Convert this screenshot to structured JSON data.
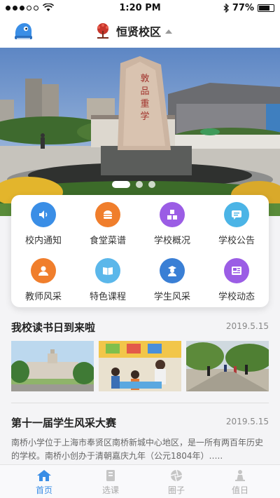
{
  "status_bar": {
    "time": "1:20 PM",
    "battery": "77%"
  },
  "header": {
    "campus": "恒贤校区"
  },
  "banner": {
    "monument_text": "敦品重学",
    "page_count": 3,
    "active_page": 0
  },
  "menu": [
    {
      "label": "校内通知",
      "icon": "speaker-icon",
      "color": "#3a8ee6"
    },
    {
      "label": "食堂菜谱",
      "icon": "burger-icon",
      "color": "#f07e2c"
    },
    {
      "label": "学校概况",
      "icon": "blocks-icon",
      "color": "#9b5de5"
    },
    {
      "label": "学校公告",
      "icon": "chat-icon",
      "color": "#4bb4e6"
    },
    {
      "label": "教师风采",
      "icon": "teacher-icon",
      "color": "#f07e2c"
    },
    {
      "label": "特色课程",
      "icon": "book-icon",
      "color": "#5bb7ea"
    },
    {
      "label": "学生风采",
      "icon": "student-icon",
      "color": "#3a7fd5"
    },
    {
      "label": "学校动态",
      "icon": "news-icon",
      "color": "#9b5de5"
    }
  ],
  "news": [
    {
      "title": "我校读书日到来啦",
      "date": "2019.5.15"
    },
    {
      "title": "第十一届学生风采大赛",
      "date": "2019.5.15",
      "desc": "南桥小学位于上海市奉贤区南桥新城中心地区，是一所有两百年历史的学校。南桥小创办于清朝嘉庆九年（公元1804年）….."
    }
  ],
  "tabs": [
    {
      "label": "首页",
      "icon": "home-icon",
      "active": true
    },
    {
      "label": "选课",
      "icon": "book-select-icon",
      "active": false
    },
    {
      "label": "圈子",
      "icon": "aperture-icon",
      "active": false
    },
    {
      "label": "值日",
      "icon": "duty-icon",
      "active": false
    }
  ]
}
